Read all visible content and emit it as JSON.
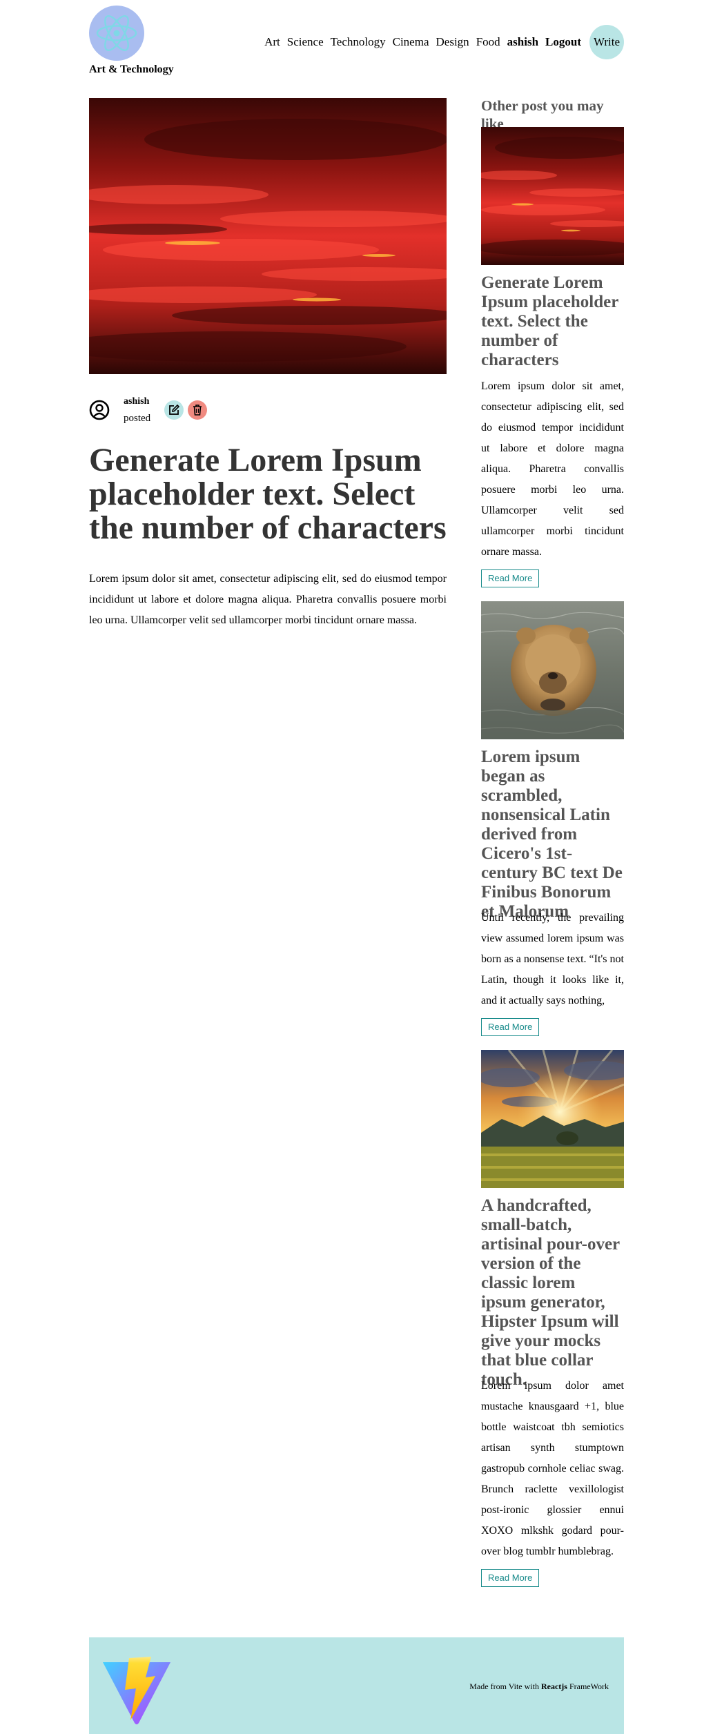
{
  "header": {
    "brand": "Art & Technology",
    "nav": [
      "Art",
      "Science",
      "Technology",
      "Cinema",
      "Design",
      "Food"
    ],
    "user": "ashish",
    "logout": "Logout",
    "write": "Write"
  },
  "post": {
    "author": "ashish",
    "posted": "posted",
    "title": "Generate Lorem Ipsum placeholder text. Select the number of characters",
    "body": "Lorem ipsum dolor sit amet, consectetur adipiscing elit, sed do eiusmod tempor incididunt ut labore et dolore magna aliqua. Pharetra convallis posuere morbi leo urna. Ullamcorper velit sed ullamcorper morbi tincidunt ornare massa."
  },
  "sidebar": {
    "heading": "Other post you may like",
    "cards": [
      {
        "title": "Generate Lorem Ipsum placeholder text. Select the number of characters",
        "desc": "Lorem ipsum dolor sit amet, consectetur adipiscing elit, sed do eiusmod tempor incididunt ut labore et dolore magna aliqua. Pharetra convallis posuere morbi leo urna. Ullamcorper velit sed ullamcorper morbi tincidunt ornare massa.",
        "button": "Read More",
        "image": "red-sky"
      },
      {
        "title": "Lorem ipsum began as scrambled, nonsensical Latin derived from Cicero's 1st-century BC text De Finibus Bonorum et Malorum",
        "desc": "Until recently, the prevailing view assumed lorem ipsum was born as a nonsense text. “It's not Latin, though it looks like it, and it actually says nothing,",
        "button": "Read More",
        "image": "bear-in-water"
      },
      {
        "title": "A handcrafted, small-batch, artisinal pour-over version of the classic lorem ipsum generator, Hipster Ipsum will give your mocks that blue collar touch.",
        "desc": "Lorem ipsum dolor amet mustache knausgaard +1, blue bottle waistcoat tbh semiotics artisan synth stumptown gastropub cornhole celiac swag. Brunch raclette vexillologist post-ironic glossier ennui XOXO mlkshk godard pour-over blog tumblr humblebrag.",
        "button": "Read More",
        "image": "sunset-landscape"
      }
    ]
  },
  "footer": {
    "prefix": "Made from Vite with",
    "framework": "Reactjs",
    "suffix": "FrameWork"
  },
  "colors": {
    "accent": "#b9e5e5",
    "logo_bg": "#a9bdf0",
    "delete": "#f08a80",
    "button_text": "#178a8a"
  }
}
